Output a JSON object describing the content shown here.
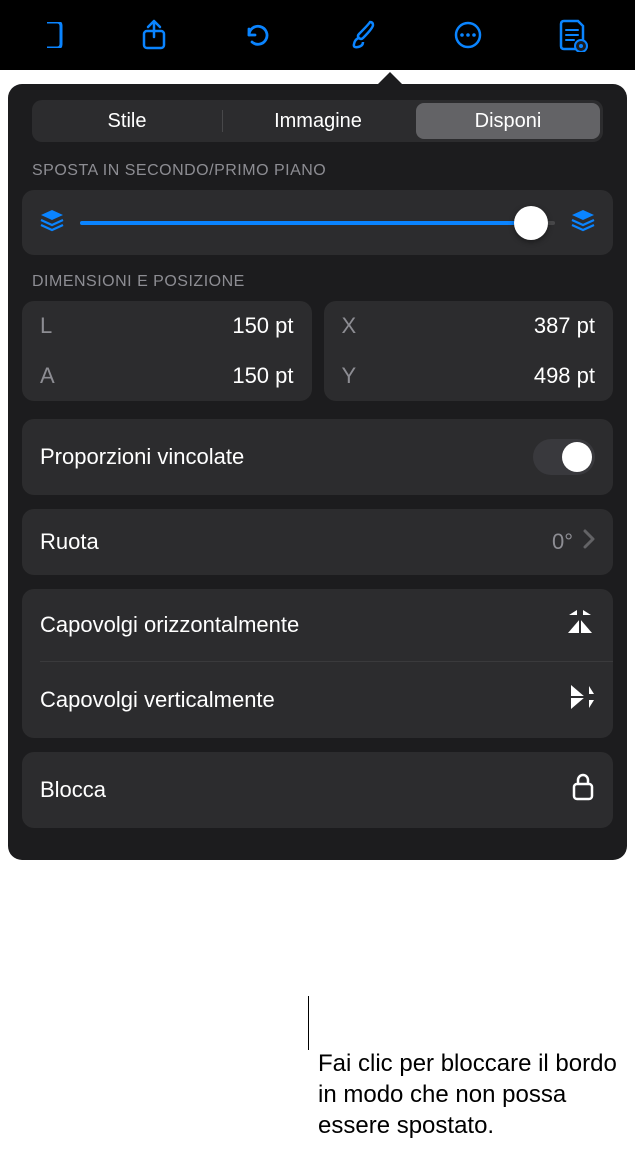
{
  "toolbar": {
    "icons": [
      "doc",
      "share",
      "undo",
      "format-brush",
      "more",
      "read-mode"
    ]
  },
  "tabs": {
    "style": "Stile",
    "image": "Immagine",
    "arrange": "Disponi",
    "active": "arrange"
  },
  "sections": {
    "layering_label": "SPOSTA IN SECONDO/PRIMO PIANO",
    "size_pos_label": "DIMENSIONI E POSIZIONE"
  },
  "layering": {
    "slider_value": 95
  },
  "size": {
    "L_label": "L",
    "L_value": "150 pt",
    "A_label": "A",
    "A_value": "150 pt",
    "X_label": "X",
    "X_value": "387 pt",
    "Y_label": "Y",
    "Y_value": "498 pt"
  },
  "constrain": {
    "label": "Proporzioni vincolate",
    "on": false
  },
  "rotate": {
    "label": "Ruota",
    "value": "0°"
  },
  "flip": {
    "horizontal": "Capovolgi orizzontalmente",
    "vertical": "Capovolgi verticalmente"
  },
  "lock": {
    "label": "Blocca"
  },
  "callout": {
    "text": "Fai clic per bloccare il bordo in modo che non possa essere spostato."
  }
}
